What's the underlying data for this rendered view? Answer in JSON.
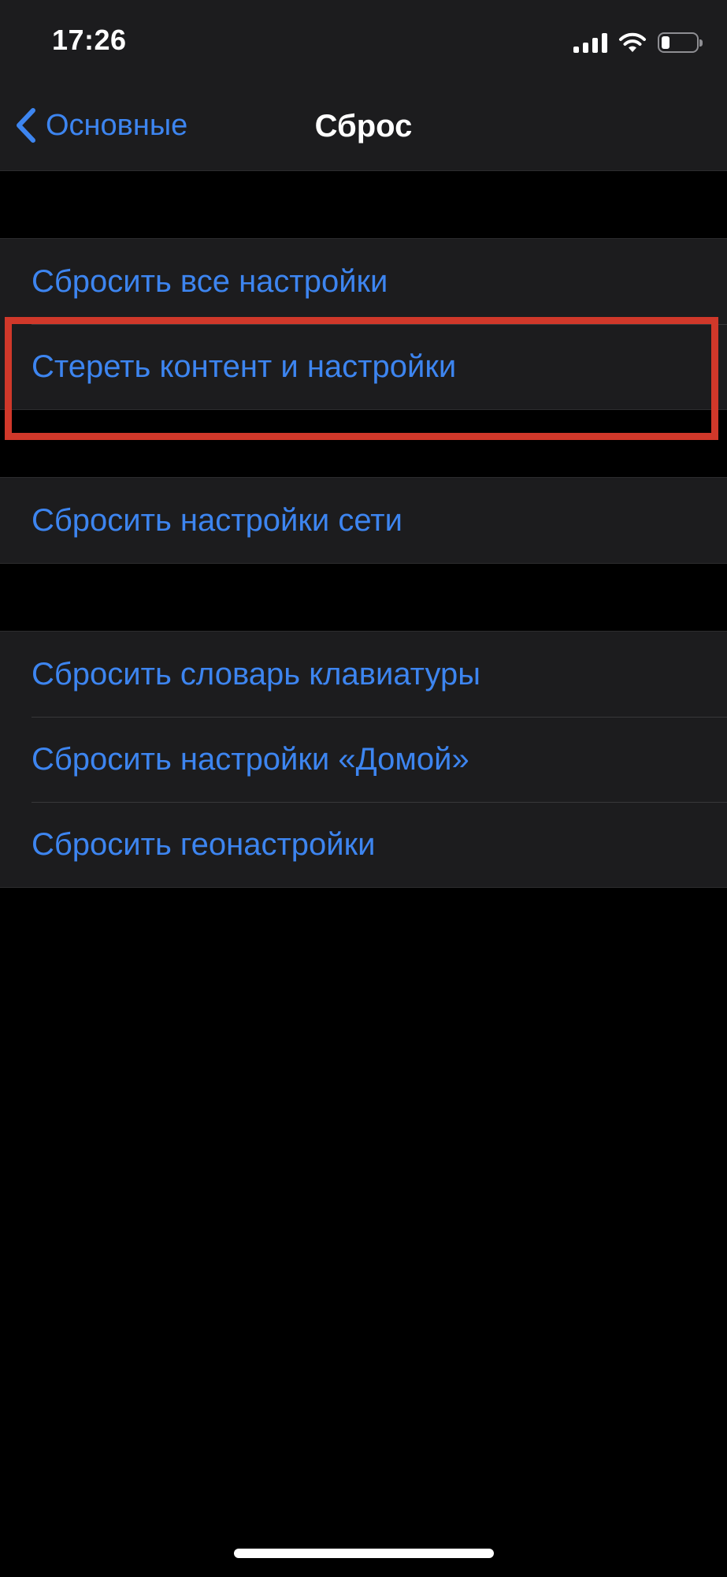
{
  "status_bar": {
    "time": "17:26",
    "icons": [
      "cellular-signal-icon",
      "wifi-icon",
      "battery-icon"
    ],
    "battery_level": 0.2
  },
  "nav": {
    "back_label": "Основные",
    "title": "Сброс"
  },
  "groups": [
    {
      "items": [
        {
          "label": "Сбросить все настройки"
        },
        {
          "label": "Стереть контент и настройки",
          "highlighted": true
        }
      ]
    },
    {
      "items": [
        {
          "label": "Сбросить настройки сети"
        }
      ]
    },
    {
      "items": [
        {
          "label": "Сбросить словарь клавиатуры"
        },
        {
          "label": "Сбросить настройки «Домой»"
        },
        {
          "label": "Сбросить геонастройки"
        }
      ]
    }
  ],
  "colors": {
    "accent": "#3d85f0",
    "background": "#000000",
    "cell": "#1c1c1e",
    "highlight": "#d0382a"
  }
}
